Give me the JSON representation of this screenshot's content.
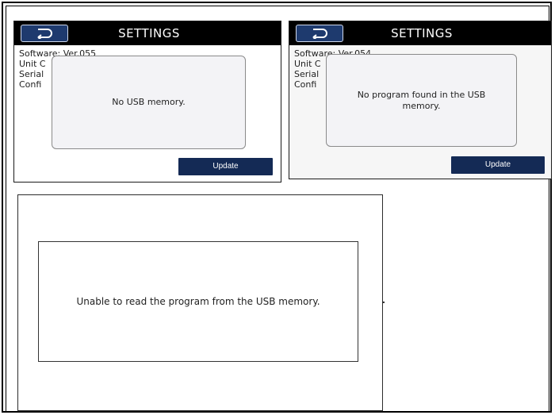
{
  "screens": [
    {
      "title": "SETTINGS",
      "info": [
        "Software: Ver.055",
        "Unit C",
        "Serial",
        "Confi"
      ],
      "message": "No USB memory.",
      "update_label": "Update"
    },
    {
      "title": "SETTINGS",
      "info": [
        "Software: Ver.054",
        "Unit C",
        "Serial",
        "Confi"
      ],
      "message": "No program found in the USB memory.",
      "update_label": "Update"
    }
  ],
  "error_screen": {
    "message": "Unable to read the program from the USB memory."
  },
  "colors": {
    "titlebar": "#000000",
    "back_button": "#1e3a6e",
    "update_button": "#142a55"
  },
  "icons": {
    "back": "back-arrow-icon"
  }
}
